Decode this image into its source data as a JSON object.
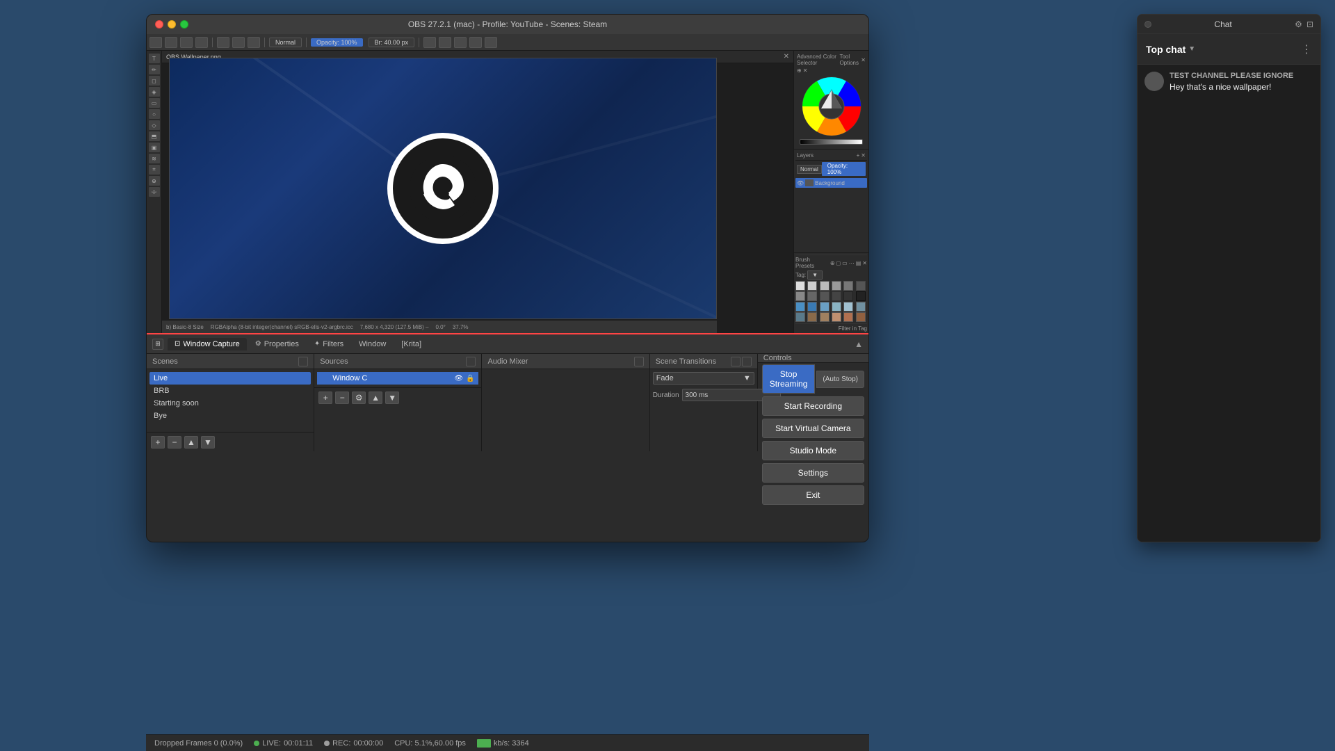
{
  "window": {
    "title": "OBS 27.2.1 (mac) - Profile: YouTube - Scenes: Steam",
    "titlebar_close": "×",
    "titlebar_minimize": "−",
    "titlebar_maximize": "□"
  },
  "preview": {
    "file_label": "OBS Wallpaper.png",
    "opacity_label": "Opacity: 100%",
    "size_label": "Br: 40.00 px",
    "bottom_info1": "b) Basic-8 Size",
    "bottom_info2": "RGBAlpha (8-bit integer(channel) sRGB-ells-v2-argbrc.icc",
    "bottom_info3": "7,680 x 4,320 (127.5 MiB) –",
    "bottom_info4": "0.0°",
    "bottom_info5": "37.7%"
  },
  "color_wheel": {
    "title": "Advanced Color Selector",
    "subtitle": "Tool Options"
  },
  "layers": {
    "title": "Layers",
    "blend_mode": "Normal",
    "opacity_label": "Opacity: 100%",
    "layer_name": "Background"
  },
  "brush_presets": {
    "title": "Brush Presets",
    "tag_label": "Tag:",
    "filter_label": "Filter in Tag"
  },
  "tabs": {
    "window_capture": "Window Capture",
    "properties": "Properties",
    "filters": "Filters",
    "window": "Window",
    "krita": "[Krita]"
  },
  "scenes": {
    "header": "Scenes",
    "items": [
      "Live",
      "BRB",
      "Starting soon",
      "Bye"
    ],
    "active": "Live"
  },
  "sources": {
    "header": "Sources",
    "items": [
      "Window C"
    ],
    "active": "Window C"
  },
  "audio_mixer": {
    "header": "Audio Mixer"
  },
  "scene_transitions": {
    "header": "Scene Transitions",
    "type": "Fade",
    "duration_label": "Duration",
    "duration_value": "300 ms"
  },
  "controls": {
    "header": "Controls",
    "stop_streaming": "Stop Streaming",
    "auto_stop": "(Auto Stop)",
    "start_recording": "Start Recording",
    "start_virtual_camera": "Start Virtual Camera",
    "studio_mode": "Studio Mode",
    "settings": "Settings",
    "exit": "Exit"
  },
  "statusbar": {
    "dropped_frames": "Dropped Frames 0 (0.0%)",
    "live_label": "LIVE:",
    "live_time": "00:01:11",
    "rec_label": "REC:",
    "rec_time": "00:00:00",
    "cpu_fps": "CPU: 5.1%,60.00 fps",
    "kbps": "kb/s: 3364"
  },
  "chat": {
    "title": "Chat",
    "channel": "Top chat",
    "messages": [
      {
        "username": "TEST CHANNEL PLEASE IGNORE",
        "text": "Hey that's a nice wallpaper!"
      }
    ]
  }
}
